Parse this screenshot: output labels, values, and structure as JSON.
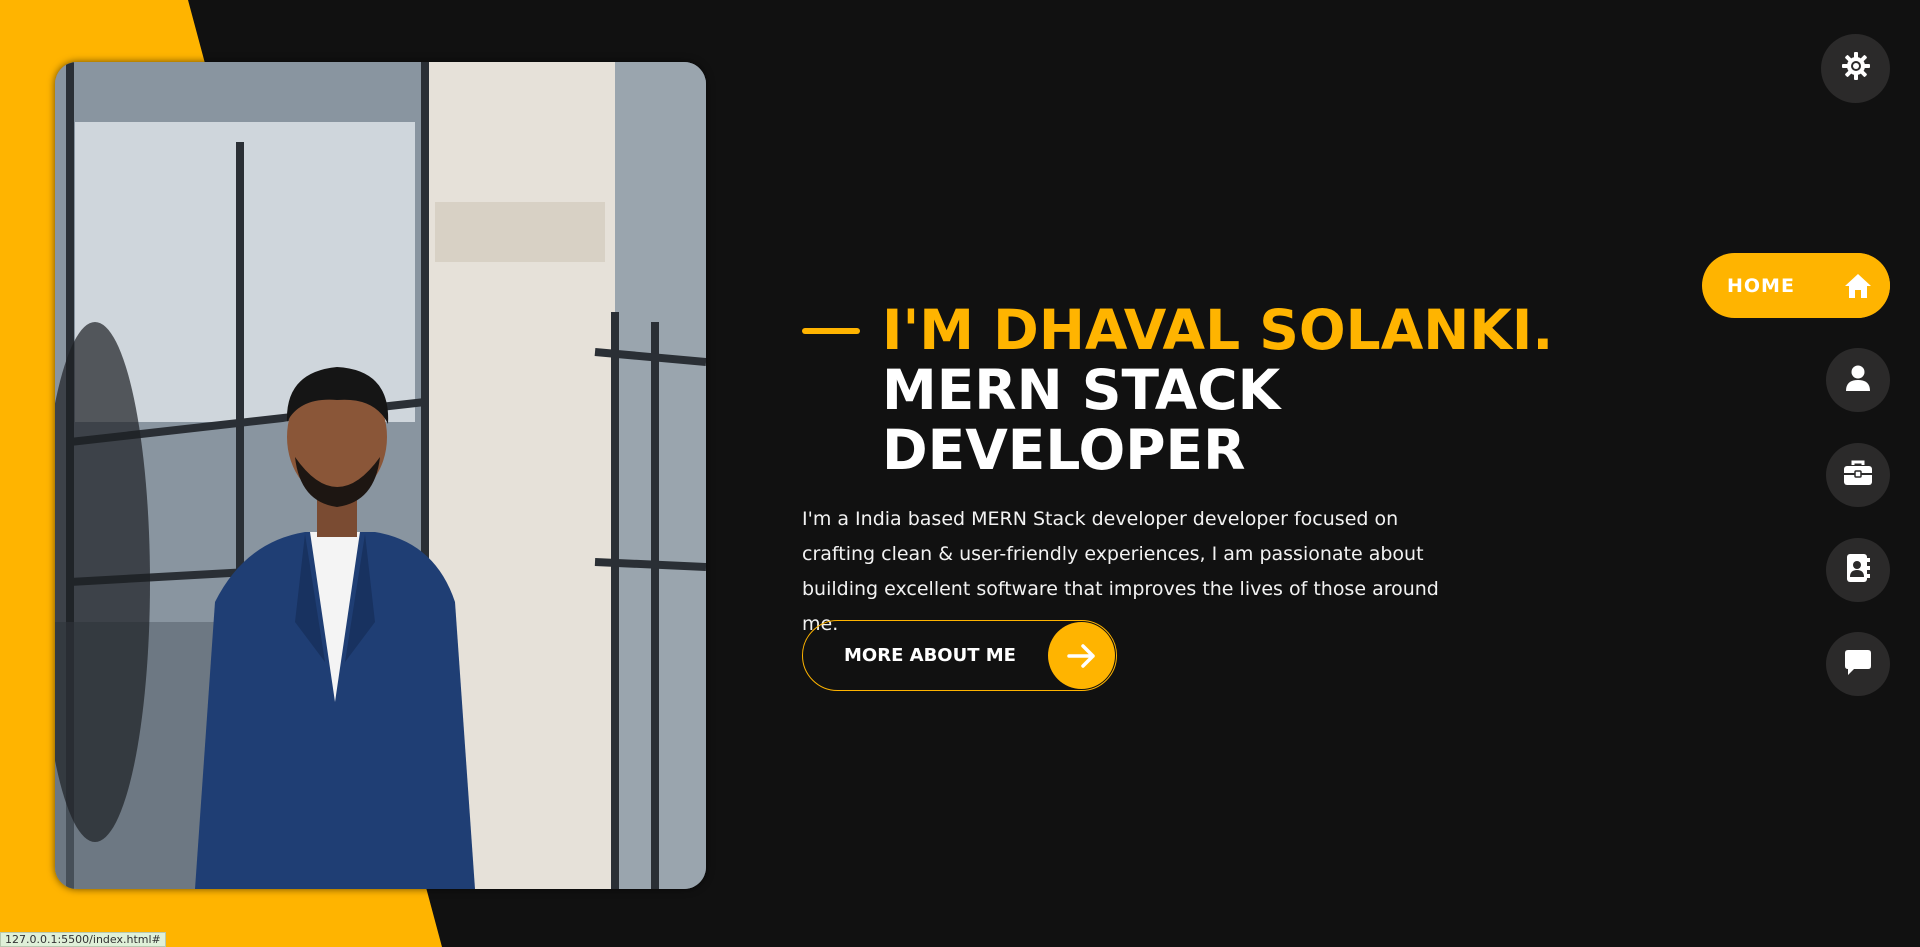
{
  "colors": {
    "accent": "#ffb400",
    "background": "#111111",
    "nav_bg": "#2b2a2a"
  },
  "hero": {
    "name_line": "I'M DHAVAL SOLANKI.",
    "role_line": "MERN STACK DEVELOPER",
    "bio": "I'm a India based MERN Stack developer developer focused on crafting clean & user-friendly experiences, I am passionate about building excellent software that improves the lives of those around me.",
    "cta_label": "MORE ABOUT ME",
    "cta_icon": "arrow-right-icon"
  },
  "theme_toggle": {
    "icon": "sun-gear-icon"
  },
  "nav": {
    "home_label": "HOME",
    "items": [
      {
        "id": "home",
        "icon": "home-icon"
      },
      {
        "id": "about",
        "icon": "user-icon"
      },
      {
        "id": "portfolio",
        "icon": "briefcase-icon"
      },
      {
        "id": "contact",
        "icon": "address-book-icon"
      },
      {
        "id": "blog",
        "icon": "chat-icon"
      }
    ]
  },
  "status_bar": {
    "url": "127.0.0.1:5500/index.html#"
  }
}
